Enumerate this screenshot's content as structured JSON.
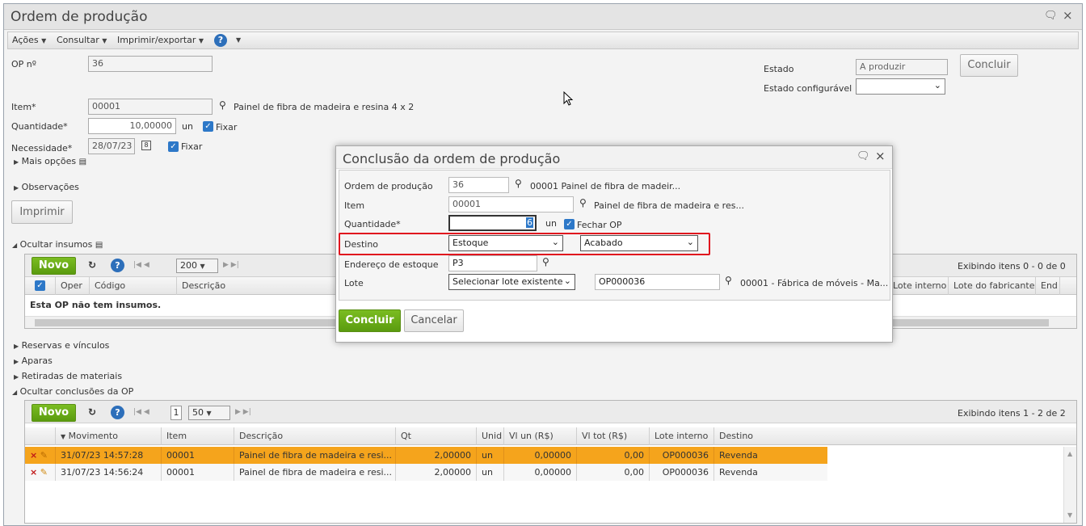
{
  "window": {
    "title": "Ordem de produção"
  },
  "menu": {
    "acoes": "Ações",
    "consultar": "Consultar",
    "imprimir_exportar": "Imprimir/exportar",
    "help": "?"
  },
  "form": {
    "op_label": "OP nº",
    "op_value": "36",
    "estado_label": "Estado",
    "estado_value": "A produzir",
    "estado_config_label": "Estado configurável",
    "estado_config_value": "",
    "concluir_label": "Concluir",
    "item_label": "Item*",
    "item_value": "00001",
    "item_desc": "Painel de fibra de madeira e resina 4 x 2",
    "quantidade_label": "Quantidade*",
    "quantidade_value": "10,00000",
    "quantidade_unit": "un",
    "fixar_label": "Fixar",
    "necessidade_label": "Necessidade*",
    "necessidade_value": "28/07/23",
    "fixar2_label": "Fixar",
    "mais_opcoes": "Mais opções",
    "observacoes": "Observações",
    "imprimir": "Imprimir",
    "ocultar_insumos": "Ocultar insumos"
  },
  "insumos_grid": {
    "novo": "Novo",
    "help": "?",
    "page_size": "200",
    "exibindo": "Exibindo itens 0 - 0 de 0",
    "headers": [
      "Oper",
      "Código",
      "Descrição",
      "Lote interno",
      "Lote do fabricante",
      "End"
    ],
    "empty": "Esta OP não tem insumos."
  },
  "sections": {
    "reservas": "Reservas e vínculos",
    "aparas": "Aparas",
    "retiradas": "Retiradas de materiais",
    "ocultar_conclusoes": "Ocultar conclusões da OP"
  },
  "conclusoes_grid": {
    "novo": "Novo",
    "help": "?",
    "page": "1",
    "page_size": "50",
    "exibindo": "Exibindo itens 1 - 2 de 2",
    "headers": [
      "Movimento",
      "Item",
      "Descrição",
      "Qt",
      "Unid",
      "Vl un (R$)",
      "Vl tot (R$)",
      "Lote interno",
      "Destino"
    ],
    "rows": [
      {
        "movimento": "31/07/23 14:57:28",
        "item": "00001",
        "descricao": "Painel de fibra de madeira e resi...",
        "qt": "2,00000",
        "unid": "un",
        "vl_un": "0,00000",
        "vl_tot": "0,00",
        "lote": "OP000036",
        "destino": "Revenda"
      },
      {
        "movimento": "31/07/23 14:56:24",
        "item": "00001",
        "descricao": "Painel de fibra de madeira e resi...",
        "qt": "2,00000",
        "unid": "un",
        "vl_un": "0,00000",
        "vl_tot": "0,00",
        "lote": "OP000036",
        "destino": "Revenda"
      }
    ]
  },
  "modal": {
    "title": "Conclusão da ordem de produção",
    "ordem_label": "Ordem de produção",
    "ordem_value": "36",
    "ordem_desc": "00001 Painel de fibra de madeir...",
    "item_label": "Item",
    "item_value": "00001",
    "item_desc": "Painel de fibra de madeira e res...",
    "quantidade_label": "Quantidade*",
    "quantidade_value": "6",
    "quantidade_unit": "un",
    "fechar_op": "Fechar OP",
    "destino_label": "Destino",
    "destino_value": "Estoque",
    "destino2_value": "Acabado",
    "endereco_label": "Endereço de estoque",
    "endereco_value": "P3",
    "lote_label": "Lote",
    "lote_select": "Selecionar lote existente",
    "lote_value": "OP000036",
    "lote_desc": "00001 - Fábrica de móveis - Ma...",
    "concluir": "Concluir",
    "cancelar": "Cancelar"
  },
  "colors": {
    "accent": "#2d78c8",
    "green": "#6aab18",
    "highlight_row": "#f5a41c",
    "red_box": "#e0141e"
  }
}
